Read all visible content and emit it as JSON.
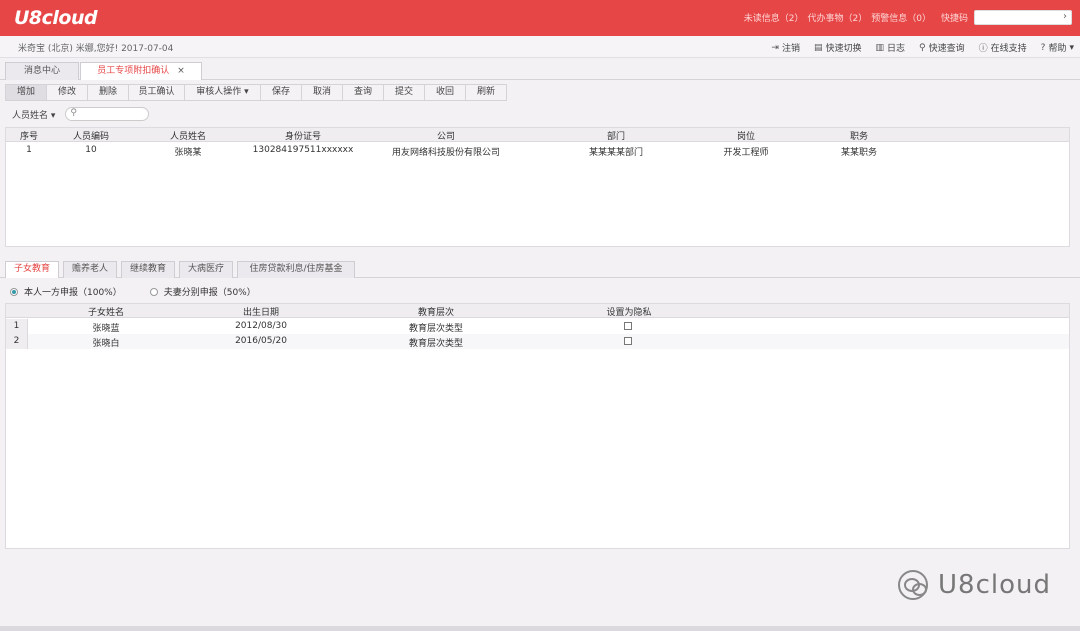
{
  "app": {
    "logo": "U8cloud",
    "top_links": {
      "unread": "未读信息（2）",
      "todo": "代办事物（2）",
      "alerts": "预警信息（0）",
      "quickcode_label": "快捷码"
    },
    "quickcode_arrow": "›"
  },
  "infobar": {
    "user_text": "米奇宝 (北京) 米娜,您好! 2017-07-04",
    "actions": [
      {
        "label": "注销",
        "icon": "⇥"
      },
      {
        "label": "快速切换",
        "icon": "▤"
      },
      {
        "label": "日志",
        "icon": "▥"
      },
      {
        "label": "快速查询",
        "icon": "⚲"
      },
      {
        "label": "在线支持",
        "icon": "ⓘ"
      },
      {
        "label": "帮助",
        "icon": "?"
      }
    ],
    "help_caret": "▾"
  },
  "page_tabs": [
    {
      "label": "消息中心"
    },
    {
      "label": "员工专项附扣确认",
      "close": "×"
    }
  ],
  "toolbar": [
    {
      "label": "增加"
    },
    {
      "label": "修改"
    },
    {
      "label": "删除"
    },
    {
      "label": "员工确认"
    },
    {
      "label": "审核人操作 ▾"
    },
    {
      "label": "保存"
    },
    {
      "label": "取消"
    },
    {
      "label": "查询"
    },
    {
      "label": "提交"
    },
    {
      "label": "收回"
    },
    {
      "label": "刷新"
    }
  ],
  "filter": {
    "label": "人员姓名",
    "caret": "▾",
    "search_icon": "⚲"
  },
  "main_grid": {
    "headers": [
      "序号",
      "人员编码",
      "人员姓名",
      "身份证号",
      "公司",
      "部门",
      "岗位",
      "职务"
    ],
    "rows": [
      [
        "1",
        "10",
        "张晓某",
        "130284197511xxxxxx",
        "用友网络科技股份有限公司",
        "某某某某部门",
        "开发工程师",
        "某某职务"
      ]
    ]
  },
  "sub_tabs": [
    {
      "label": "子女教育"
    },
    {
      "label": "赡养老人"
    },
    {
      "label": "继续教育"
    },
    {
      "label": "大病医疗"
    },
    {
      "label": "住房贷款利息/住房基金"
    }
  ],
  "radios": [
    {
      "label": "本人一方申报（100%）",
      "checked": true
    },
    {
      "label": "夫妻分别申报（50%）",
      "checked": false
    }
  ],
  "child_grid": {
    "headers": [
      "子女姓名",
      "出生日期",
      "教育层次",
      "设置为隐私"
    ],
    "rows": [
      {
        "num": "1",
        "name": "张晓蓝",
        "birth": "2012/08/30",
        "level": "教育层次类型"
      },
      {
        "num": "2",
        "name": "张晓白",
        "birth": "2016/05/20",
        "level": "教育层次类型"
      }
    ]
  },
  "watermark": {
    "text": "U8cloud"
  },
  "colors": {
    "brand_red": "#e64646"
  }
}
